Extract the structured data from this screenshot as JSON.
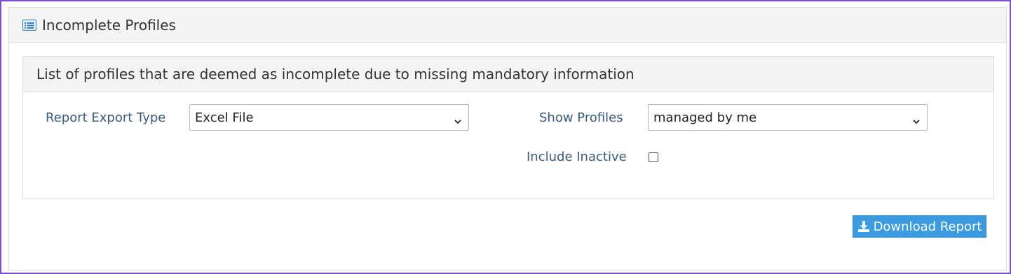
{
  "outer_panel": {
    "title": "Incomplete Profiles",
    "icon": "list-icon"
  },
  "inner_panel": {
    "description": "List of profiles that are deemed as incomplete due to missing mandatory information"
  },
  "form": {
    "report_export_type": {
      "label": "Report Export Type",
      "selected": "Excel File"
    },
    "show_profiles": {
      "label": "Show Profiles",
      "selected": "managed by me"
    },
    "include_inactive": {
      "label": "Include Inactive",
      "checked": false
    }
  },
  "actions": {
    "download_label": "Download Report",
    "download_icon": "download-icon"
  },
  "colors": {
    "accent": "#3a9be0",
    "label_text": "#3b5a7d",
    "frame": "#7b4fd6"
  }
}
